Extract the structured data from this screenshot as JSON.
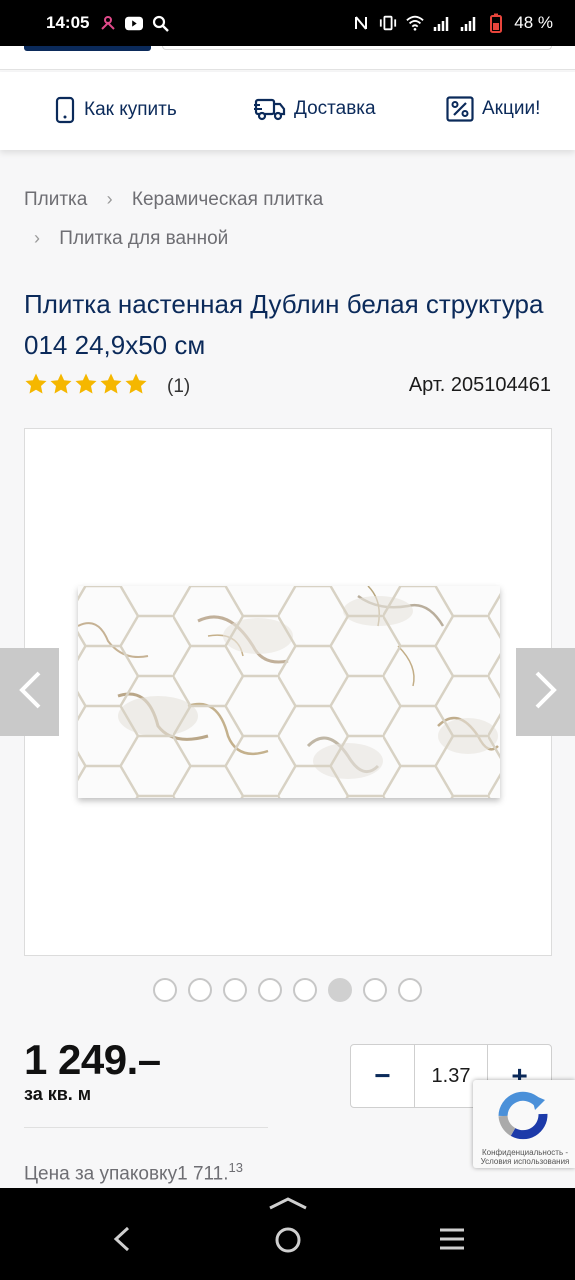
{
  "status_bar": {
    "time": "14:05",
    "battery": "48 %",
    "icons": [
      "flower-icon",
      "youtube-icon",
      "search-icon",
      "nfc-icon",
      "vibrate-icon",
      "wifi-icon",
      "signal-icon",
      "signal-icon",
      "battery-icon"
    ]
  },
  "nav": {
    "how_to_buy": "Как купить",
    "delivery": "Доставка",
    "promos": "Акции!"
  },
  "breadcrumbs": [
    "Плитка",
    "Керамическая плитка",
    "Плитка для ванной"
  ],
  "product": {
    "title": "Плитка настенная Дублин белая структура 014 24,9x50 см",
    "rating": 5,
    "reviews": "(1)",
    "article": "Арт. 205104461"
  },
  "gallery": {
    "dot_count": 8,
    "active_index": 5
  },
  "price": {
    "value": "1 249.–",
    "unit": "за кв. м",
    "pack_label": "Цена за упаковку",
    "pack_value": "1 711.",
    "pack_cents": "13"
  },
  "quantity": {
    "minus": "−",
    "value": "1.37",
    "plus": "+"
  },
  "recaptcha": {
    "line1": "Конфиденциальность -",
    "line2": "Условия использования"
  },
  "colors": {
    "brand": "#0b2a5a",
    "star": "#f5b700"
  }
}
